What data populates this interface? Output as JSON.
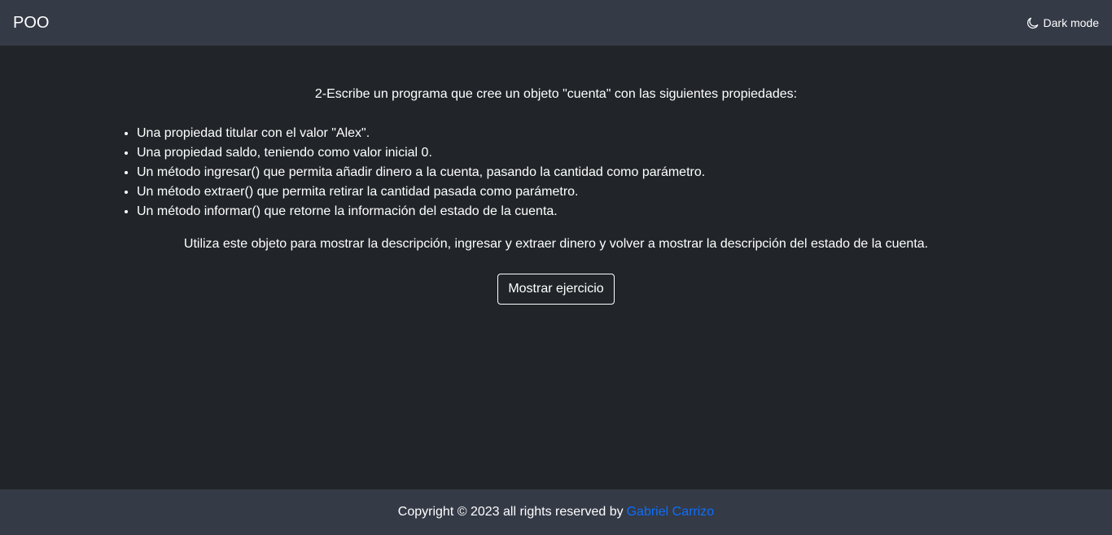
{
  "navbar": {
    "brand": "POO",
    "mode_toggle": {
      "icon": "moon-icon",
      "label": "Dark mode"
    }
  },
  "main": {
    "intro": "2-Escribe un programa que cree un objeto \"cuenta\" con las siguientes propiedades:",
    "items": [
      "Una propiedad titular con el valor \"Alex\".",
      "Una propiedad saldo, teniendo como valor inicial 0.",
      "Un método ingresar() que permita añadir dinero a la cuenta, pasando la cantidad como parámetro.",
      "Un método extraer() que permita retirar la cantidad pasada como parámetro.",
      "Un método informar() que retorne la información del estado de la cuenta."
    ],
    "outro": "Utiliza este objeto para mostrar la descripción, ingresar y extraer dinero y volver a mostrar la descripción del estado de la cuenta.",
    "button_label": "Mostrar ejercicio"
  },
  "footer": {
    "copyright": "Copyright © 2023 all rights reserved by",
    "author": "Gabriel Carrizo"
  },
  "colors": {
    "background": "#212529",
    "bars": "#343a46",
    "link": "#0d6efd",
    "text": "#ffffff"
  }
}
